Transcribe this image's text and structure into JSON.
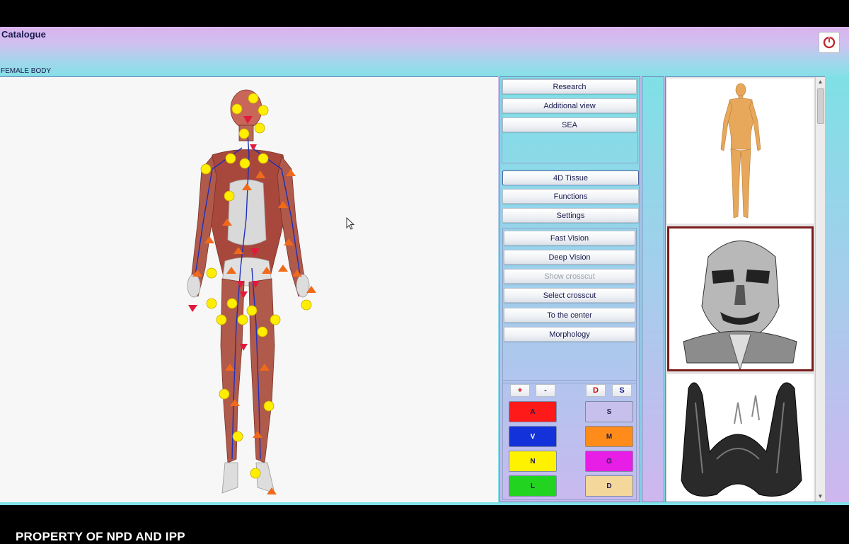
{
  "window": {
    "title": "Catalogue",
    "subtitle": "FEMALE BODY",
    "watermark": "PROPERTY OF NPD AND IPP"
  },
  "icons": {
    "close": "power-icon",
    "cursor": "pointer-cursor-icon"
  },
  "panel": {
    "group1": [
      "Research",
      "Additional view",
      "SEA"
    ],
    "group2": [
      "4D Tissue",
      "Functions",
      "Settings"
    ],
    "group2_active": "4D Tissue",
    "group3": [
      "Fast Vision",
      "Deep Vision",
      "Show crosscut",
      "Select crosscut",
      "To the center",
      "Morphology"
    ],
    "group3_disabled": "Show crosscut",
    "controls": {
      "plus": "+",
      "minus": "-",
      "d": "D",
      "s": "S"
    },
    "layers_left": [
      {
        "label": "A",
        "color": "#ff1a1a"
      },
      {
        "label": "V",
        "color": "#1432d9"
      },
      {
        "label": "N",
        "color": "#fff200"
      },
      {
        "label": "L",
        "color": "#22d41f"
      }
    ],
    "layers_right": [
      {
        "label": "S",
        "color": "#c8c0ec"
      },
      {
        "label": "M",
        "color": "#ff8c1a"
      },
      {
        "label": "G",
        "color": "#e61ee6"
      },
      {
        "label": "D",
        "color": "#f4d79a"
      }
    ]
  },
  "thumbnails": [
    "female-body-thumbnail",
    "head-muscles-thumbnail",
    "thyroid-gland-thumbnail"
  ]
}
